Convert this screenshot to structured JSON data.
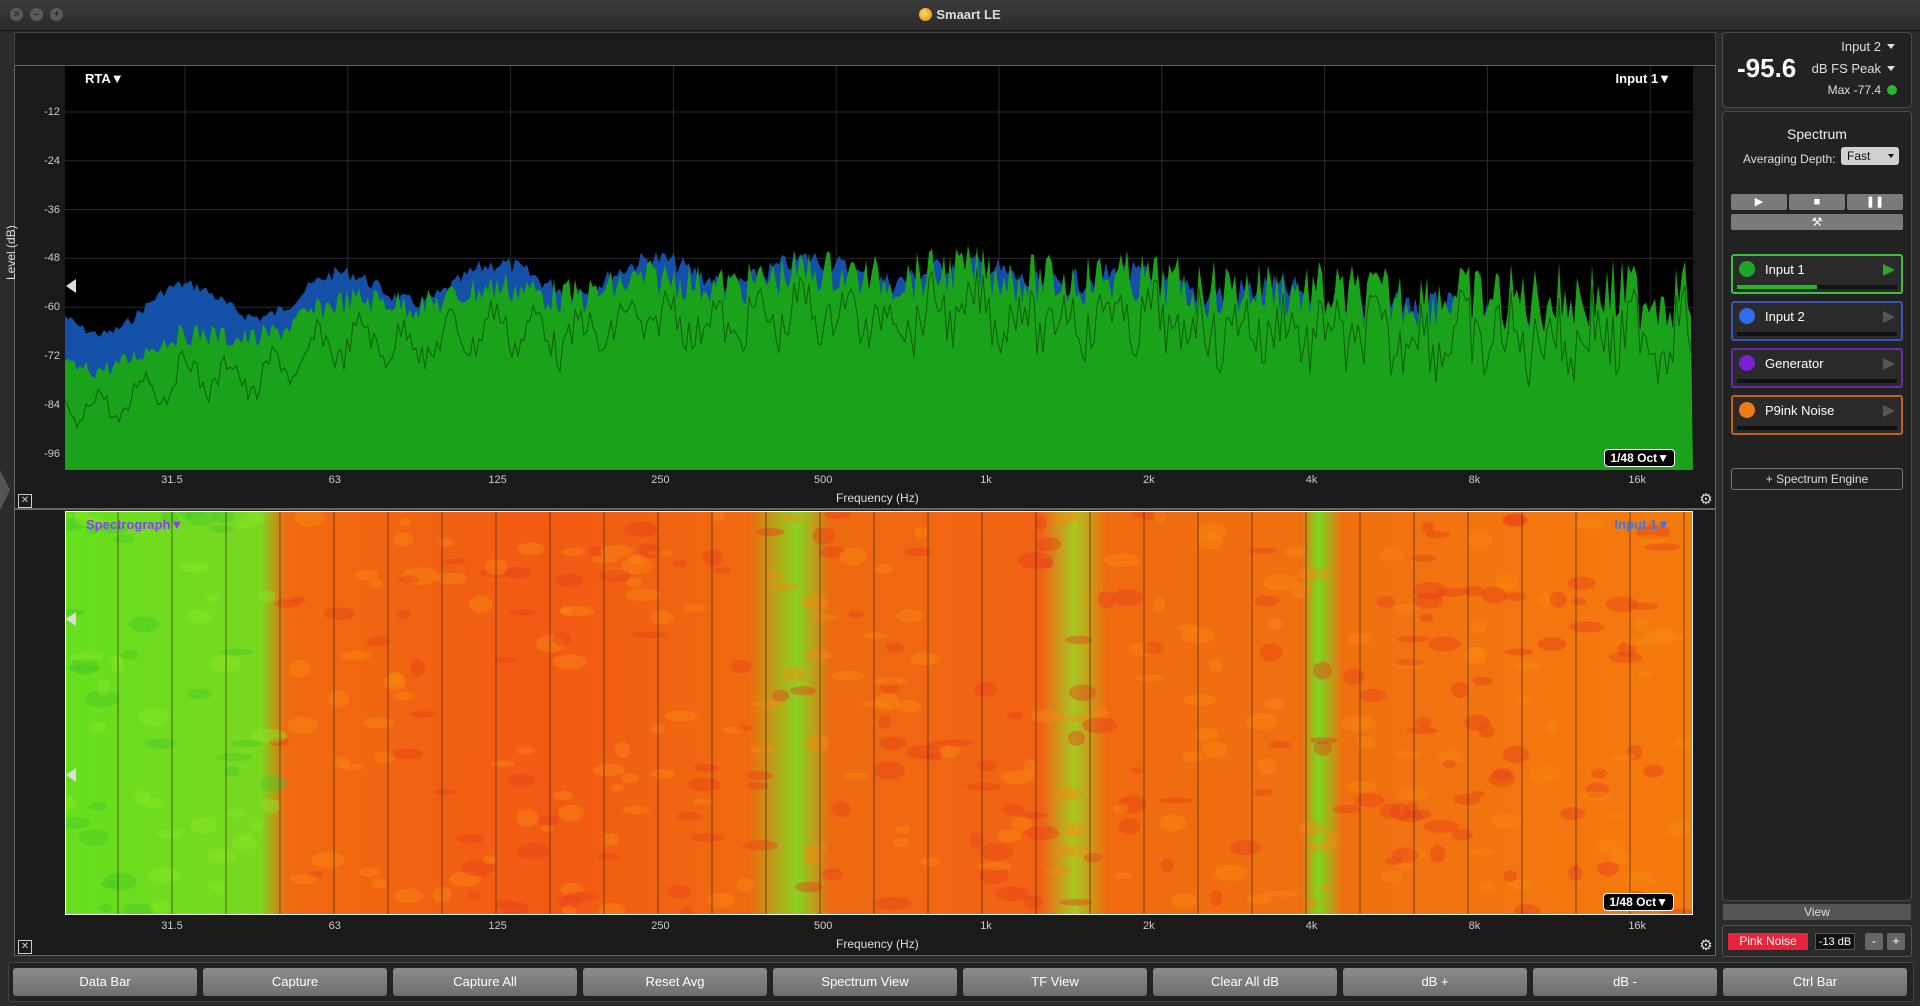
{
  "app": {
    "title": "Smaart LE"
  },
  "rta": {
    "mode_label": "RTA▼",
    "input_label": "Input 1▼",
    "ylabel": "Level (dB)",
    "xlabel": "Frequency (Hz)",
    "yticks": [
      "-12",
      "-24",
      "-36",
      "-48",
      "-60",
      "-72",
      "-84",
      "-96"
    ],
    "xticks": [
      "31.5",
      "63",
      "125",
      "250",
      "500",
      "1k",
      "2k",
      "4k",
      "8k",
      "16k"
    ],
    "resolution": "1/48 Oct▼"
  },
  "spectrograph": {
    "mode_label": "Spectrograph▼",
    "input_label": "Input 1▼",
    "xlabel": "Frequency (Hz)",
    "xticks": [
      "31.5",
      "63",
      "125",
      "250",
      "500",
      "1k",
      "2k",
      "4k",
      "8k",
      "16k"
    ],
    "resolution": "1/48 Oct▼"
  },
  "meter": {
    "value": "-95.6",
    "source": "Input 2",
    "scale": "dB FS Peak",
    "max": "Max -77.4",
    "status_color": "#2ab830"
  },
  "spectrum_panel": {
    "title": "Spectrum",
    "averaging_label": "Averaging Depth:",
    "averaging_value": "Fast",
    "transport": {
      "play": "▶",
      "stop": "■",
      "pause": "❚❚"
    },
    "tools_icon": "⚒",
    "measurements": [
      {
        "name": "Input 1",
        "color": "#1fa62a",
        "border": "#3fbf3f"
      },
      {
        "name": "Input 2",
        "color": "#2f6cf0",
        "border": "#3a55b5"
      },
      {
        "name": "Generator",
        "color": "#7a1fd6",
        "border": "#6a2aa6"
      },
      {
        "name": "P9ink Noise",
        "color": "#f07a18",
        "border": "#c0621a"
      }
    ],
    "add_engine": "+ Spectrum Engine"
  },
  "view_button": "View",
  "generator": {
    "button": "Pink Noise",
    "level": "-13 dB",
    "minus": "-",
    "plus": "+"
  },
  "ctrl_bar": {
    "buttons": [
      "Data Bar",
      "Capture",
      "Capture All",
      "Reset Avg",
      "Spectrum View",
      "TF View",
      "Clear All dB",
      "dB +",
      "dB -",
      "Ctrl Bar"
    ]
  }
}
